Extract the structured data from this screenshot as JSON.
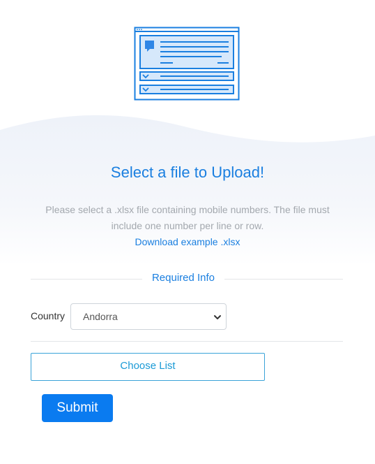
{
  "hero": {
    "title": "Select a file to Upload!",
    "description": "Please select a .xlsx file containing mobile numbers. The file must include one number per line or row.",
    "example_link": "Download example .xlsx",
    "illustration_icon": "document-form-illustration-icon"
  },
  "form": {
    "section_label": "Required Info",
    "country_label": "Country",
    "country_value": "Andorra",
    "choose_button": "Choose List",
    "submit_button": "Submit"
  },
  "colors": {
    "accent": "#1a7fe0",
    "button_primary": "#0a7bf0",
    "outline_button": "#3aa3d8",
    "hero_background": "#f4f7fc",
    "muted_text": "#a3a8ae"
  }
}
